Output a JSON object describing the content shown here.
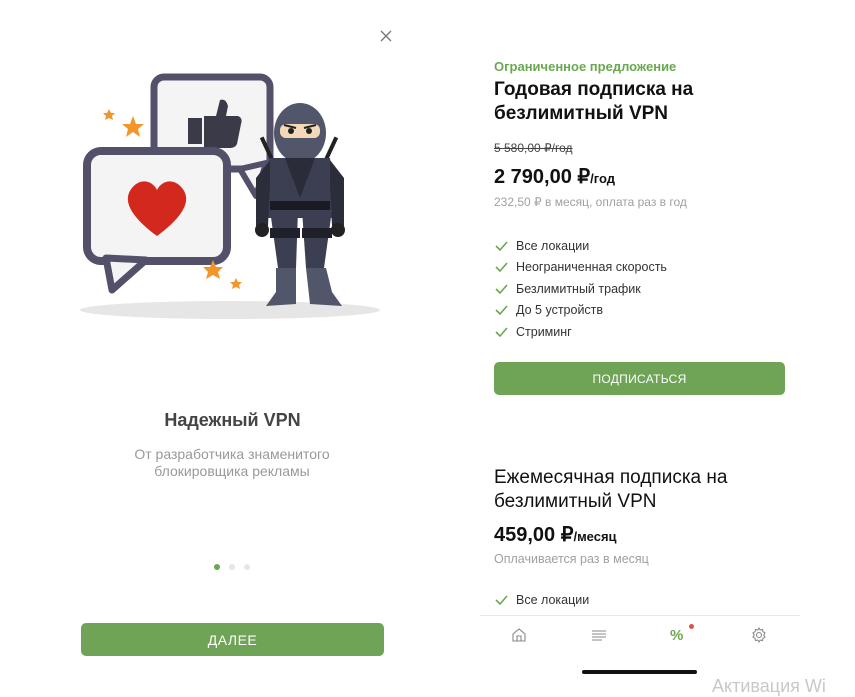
{
  "left_panel": {
    "close_icon": "close-icon",
    "illustration": "ninja-with-speech-bubbles",
    "title": "Надежный VPN",
    "subtitle": "От разработчика знаменитого блокировщика рекламы",
    "pager": {
      "count": 3,
      "active": 1
    },
    "next_label": "ДАЛЕЕ"
  },
  "annual_plan": {
    "offer_label": "Ограниченное предложение",
    "title": "Годовая подписка на безлимитный VPN",
    "old_price": "5 580,00 ₽/год",
    "price": "2 790,00 ₽",
    "price_unit": "/год",
    "price_note": "232,50 ₽ в месяц, оплата раз в год",
    "features": [
      "Все локации",
      "Неограниченная скорость",
      "Безлимитный трафик",
      "До 5 устройств",
      "Стриминг"
    ],
    "subscribe_label": "ПОДПИСАТЬСЯ"
  },
  "monthly_plan": {
    "title": "Ежемесячная подписка на безлимитный VPN",
    "price": "459,00 ₽",
    "price_unit": "/месяц",
    "price_note": "Оплачивается раз в месяц",
    "features": [
      "Все локации"
    ]
  },
  "tabbar": {
    "tabs": [
      {
        "icon": "home-icon"
      },
      {
        "icon": "list-icon"
      },
      {
        "icon": "percent-icon",
        "active": true,
        "badge": true,
        "label": "%"
      },
      {
        "icon": "gear-icon"
      }
    ]
  },
  "watermark": "Активация Wi",
  "colors": {
    "accent": "#6fa356",
    "offer_label": "#6aa84f",
    "badge": "#d9534f"
  }
}
